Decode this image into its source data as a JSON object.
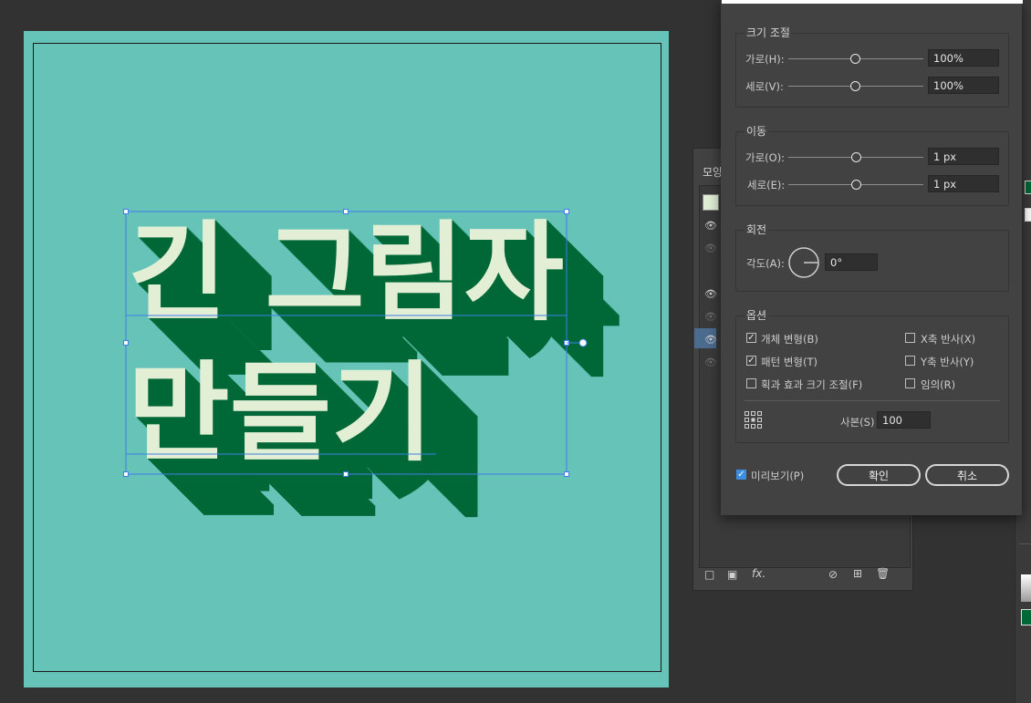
{
  "artboard": {
    "headline_line1": "긴 그림자",
    "headline_line2": "만들기",
    "background_color": "#65c3b7",
    "text_color": "#e2efd5",
    "shadow_color": "#006837"
  },
  "appearance_panel": {
    "title": "모양"
  },
  "dialog": {
    "scale": {
      "title": "크기 조절",
      "horizontal_label": "가로(H):",
      "horizontal_value": "100%",
      "vertical_label": "세로(V):",
      "vertical_value": "100%"
    },
    "move": {
      "title": "이동",
      "horizontal_label": "가로(O):",
      "horizontal_value": "1 px",
      "vertical_label": "세로(E):",
      "vertical_value": "1 px"
    },
    "rotate": {
      "title": "회전",
      "angle_label": "각도(A):",
      "angle_value": "0°"
    },
    "options": {
      "title": "옵션",
      "transform_objects": {
        "label": "개체 변형(B)",
        "checked": true
      },
      "transform_patterns": {
        "label": "패턴 변형(T)",
        "checked": true
      },
      "scale_strokes": {
        "label": "획과 효과 크기 조절(F)",
        "checked": false
      },
      "reflect_x": {
        "label": "X축 반사(X)",
        "checked": false
      },
      "reflect_y": {
        "label": "Y축 반사(Y)",
        "checked": false
      },
      "random": {
        "label": "임의(R)",
        "checked": false
      },
      "copies_label": "사본(S)",
      "copies_value": "100"
    },
    "preview": {
      "label": "미리보기(P)",
      "checked": true
    },
    "ok_label": "확인",
    "cancel_label": "취소",
    "accent_color": "#3b8ee0"
  }
}
